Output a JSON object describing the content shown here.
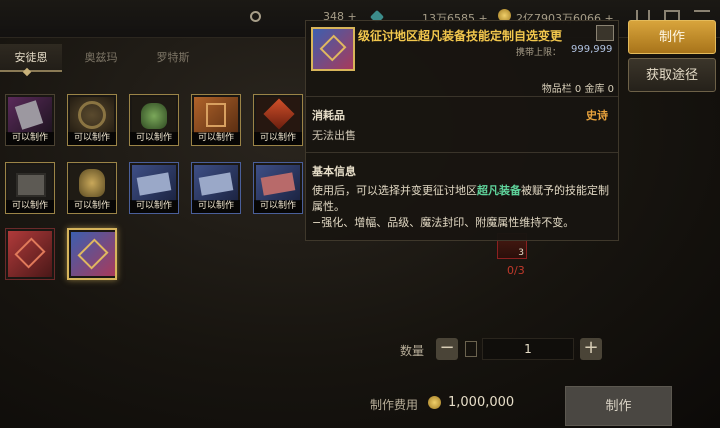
{
  "topbar": {
    "currencies": [
      {
        "name": "currency-1",
        "value": "348 +"
      },
      {
        "name": "currency-2",
        "value": "13万6585 +"
      },
      {
        "name": "currency-3",
        "value": "2亿7903万6066 +"
      }
    ]
  },
  "tabs": [
    {
      "label": "安徒恩"
    },
    {
      "label": "奥兹玛"
    },
    {
      "label": "罗特斯"
    }
  ],
  "grid": {
    "slot_label": "可以制作",
    "items": [
      {
        "icon": "seal-box-icon",
        "labelled": true
      },
      {
        "icon": "gear-chest-icon",
        "labelled": true
      },
      {
        "icon": "jade-urn-icon",
        "labelled": true
      },
      {
        "icon": "orange-card-icon",
        "labelled": true
      },
      {
        "icon": "red-gem-icon",
        "labelled": true
      },
      {
        "icon": "iron-chest-icon",
        "labelled": true
      },
      {
        "icon": "gold-urn-icon",
        "labelled": true
      },
      {
        "icon": "blue-ticket-icon",
        "labelled": true
      },
      {
        "icon": "blue-ticket-2-icon",
        "labelled": true
      },
      {
        "icon": "red-ticket-icon",
        "labelled": true
      },
      {
        "icon": "red-card-icon",
        "labelled": false
      },
      {
        "icon": "blue-card-icon",
        "labelled": false
      }
    ]
  },
  "buttons": {
    "make": "制作",
    "obtain": "获取途径"
  },
  "tooltip": {
    "title": "级征讨地区超凡装备技能定制自选变更",
    "limit_label": "携带上限：",
    "limit_value": "999,999",
    "inventory": "物品栏 0 金库 0",
    "category": "消耗品",
    "rarity": "史诗",
    "sell": "无法出售",
    "basic_info": "基本信息",
    "desc_pre": "使用后，可以选择并变更征讨地区",
    "desc_highlight": "超凡装备",
    "desc_post": "被赋予的技能定制属性。",
    "desc_line2": "−强化、增幅、品级、魔法封印、附魔属性维持不变。"
  },
  "craft": {
    "material_badge": "3",
    "material_count": "0/3",
    "qty_label": "数量",
    "qty_value": "1",
    "fee_label": "制作费用",
    "fee_value": "1,000,000",
    "craft_button": "制作"
  }
}
